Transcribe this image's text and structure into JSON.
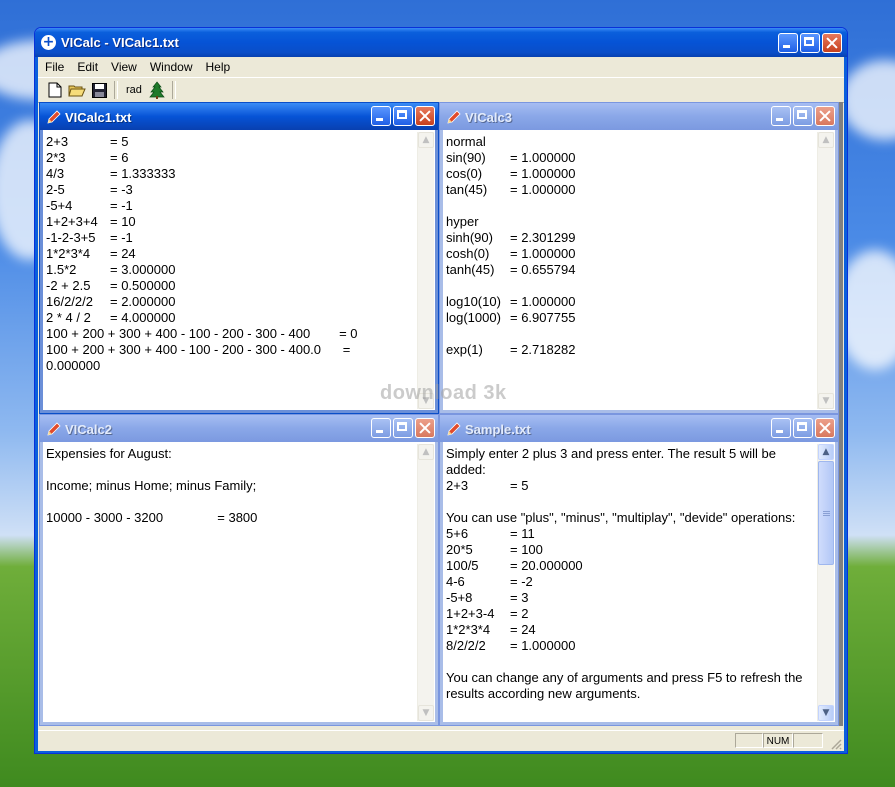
{
  "app": {
    "title": "VICalc - VICalc1.txt"
  },
  "menu": [
    "File",
    "Edit",
    "View",
    "Window",
    "Help"
  ],
  "toolbar": {
    "rad_label": "rad",
    "icons": [
      "new-file-icon",
      "open-folder-icon",
      "save-disk-icon",
      "tree-icon"
    ]
  },
  "windows": {
    "calc1": {
      "title": "VICalc1.txt",
      "lines": [
        [
          "2+3",
          "= 5"
        ],
        [
          "2*3",
          "= 6"
        ],
        [
          "4/3",
          "= 1.333333"
        ],
        [
          "2-5",
          "= -3"
        ],
        [
          "-5+4",
          "= -1"
        ],
        [
          "1+2+3+4",
          "= 10"
        ],
        [
          "-1-2-3+5",
          "= -1"
        ],
        [
          "1*2*3*4",
          "= 24"
        ],
        [
          "1.5*2",
          "= 3.000000"
        ],
        [
          "-2 + 2.5",
          "= 0.500000"
        ],
        [
          "16/2/2/2",
          "= 2.000000"
        ],
        [
          "2 * 4 / 2",
          "= 4.000000"
        ]
      ],
      "long_lines": [
        "100 + 200 + 300 + 400 - 100 - 200 - 300 - 400        = 0",
        "100 + 200 + 300 + 400 - 100 - 200 - 300 - 400.0      =",
        "0.000000"
      ]
    },
    "calc3": {
      "title": "VICalc3",
      "lines": [
        [
          "normal",
          ""
        ],
        [
          "sin(90)",
          "= 1.000000"
        ],
        [
          "cos(0)",
          "= 1.000000"
        ],
        [
          "tan(45)",
          "= 1.000000"
        ],
        [
          "",
          ""
        ],
        [
          "hyper",
          ""
        ],
        [
          "sinh(90)",
          "= 2.301299"
        ],
        [
          "cosh(0)",
          "= 1.000000"
        ],
        [
          "tanh(45)",
          "= 0.655794"
        ],
        [
          "",
          ""
        ],
        [
          "log10(10)",
          "= 1.000000"
        ],
        [
          "log(1000)",
          "= 6.907755"
        ],
        [
          "",
          ""
        ],
        [
          "exp(1)",
          "= 2.718282"
        ]
      ]
    },
    "calc2": {
      "title": "VICalc2",
      "lines": [
        "Expensies for August:",
        "",
        "Income; minus Home; minus Family;",
        "",
        "10000 - 3000 - 3200               = 3800"
      ]
    },
    "sample": {
      "title": "Sample.txt",
      "intro1": "Simply enter 2 plus 3 and press enter. The result 5 will be added:",
      "ex1": [
        "2+3",
        "= 5"
      ],
      "intro2": "You can use \"plus\", \"minus\", \"multiplay\", \"devide\" operations:",
      "lines": [
        [
          "5+6",
          "= 11"
        ],
        [
          "20*5",
          "= 100"
        ],
        [
          "100/5",
          "= 20.000000"
        ],
        [
          "4-6",
          "= -2"
        ],
        [
          "-5+8",
          "= 3"
        ],
        [
          "1+2+3-4",
          "= 2"
        ],
        [
          "1*2*3*4",
          "= 24"
        ],
        [
          "8/2/2/2",
          "= 1.000000"
        ]
      ],
      "outro": "You can change any of arguments and press F5 to refresh the results according new arguments."
    }
  },
  "status": {
    "num": "NUM"
  },
  "watermark": "download 3k"
}
